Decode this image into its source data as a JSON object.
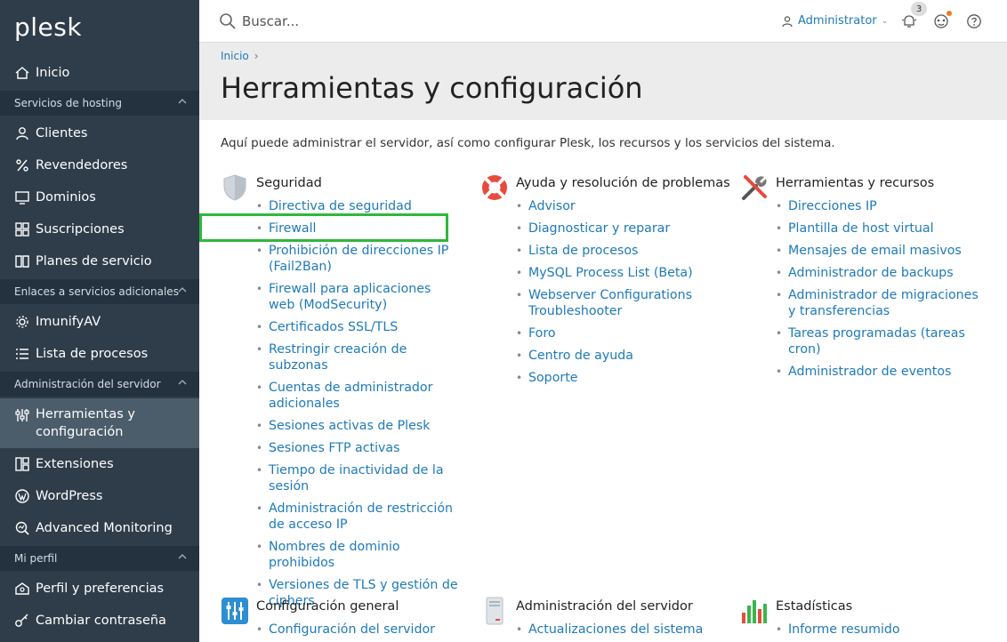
{
  "brand": {
    "logo": "plesk"
  },
  "sidebar": {
    "items": [
      {
        "label": "Inicio",
        "icon": "home-icon"
      },
      {
        "label": "Clientes",
        "icon": "user-icon"
      },
      {
        "label": "Revendedores",
        "icon": "percent-icon"
      },
      {
        "label": "Dominios",
        "icon": "monitor-icon"
      },
      {
        "label": "Suscripciones",
        "icon": "grid-icon"
      },
      {
        "label": "Planes de servicio",
        "icon": "book-icon"
      },
      {
        "label": "ImunifyAV",
        "icon": "gear-icon"
      },
      {
        "label": "Lista de procesos",
        "icon": "list-icon"
      },
      {
        "label": "Herramientas y configuración",
        "icon": "sliders-icon"
      },
      {
        "label": "Extensiones",
        "icon": "extensions-icon"
      },
      {
        "label": "WordPress",
        "icon": "wordpress-icon"
      },
      {
        "label": "Advanced Monitoring",
        "icon": "monitoring-icon"
      },
      {
        "label": "Perfil y preferencias",
        "icon": "profile-icon"
      },
      {
        "label": "Cambiar contraseña",
        "icon": "key-icon"
      }
    ],
    "sections": [
      "Servicios de hosting",
      "Enlaces a servicios adicionales",
      "Administración del servidor",
      "Mi perfil"
    ]
  },
  "topbar": {
    "search_placeholder": "Buscar...",
    "user": "Administrator",
    "notifications_count": "3"
  },
  "breadcrumb": {
    "home": "Inicio"
  },
  "page": {
    "title": "Herramientas y configuración",
    "intro": "Aquí puede administrar el servidor, así como configurar Plesk, los recursos y los servicios del sistema."
  },
  "groups": {
    "security": {
      "title": "Seguridad",
      "links": [
        "Directiva de seguridad",
        "Firewall",
        "Prohibición de direcciones IP (Fail2Ban)",
        "Firewall para aplicaciones web (ModSecurity)",
        "Certificados SSL/TLS",
        "Restringir creación de subzonas",
        "Cuentas de administrador adicionales",
        "Sesiones activas de Plesk",
        "Sesiones FTP activas",
        "Tiempo de inactividad de la sesión",
        "Administración de restricción de acceso IP",
        "Nombres de dominio prohibidos",
        "Versiones de TLS y gestión de ciphers"
      ]
    },
    "help": {
      "title": "Ayuda y resolución de problemas",
      "links": [
        "Advisor",
        "Diagnosticar y reparar",
        "Lista de procesos",
        "MySQL Process List (Beta)",
        "Webserver Configurations Troubleshooter",
        "Foro",
        "Centro de ayuda",
        "Soporte"
      ]
    },
    "tools": {
      "title": "Herramientas y recursos",
      "links": [
        "Direcciones IP",
        "Plantilla de host virtual",
        "Mensajes de email masivos",
        "Administrador de backups",
        "Administrador de migraciones y transferencias",
        "Tareas programadas (tareas cron)",
        "Administrador de eventos"
      ]
    },
    "general": {
      "title": "Configuración general",
      "links": [
        "Configuración del servidor"
      ]
    },
    "server": {
      "title": "Administración del servidor",
      "links": [
        "Actualizaciones del sistema"
      ]
    },
    "stats": {
      "title": "Estadísticas",
      "links": [
        "Informe resumido"
      ]
    }
  },
  "colors": {
    "sidebar_bg": "#2f3d4a",
    "link": "#1e7ab8",
    "highlight": "#2eb83b"
  }
}
